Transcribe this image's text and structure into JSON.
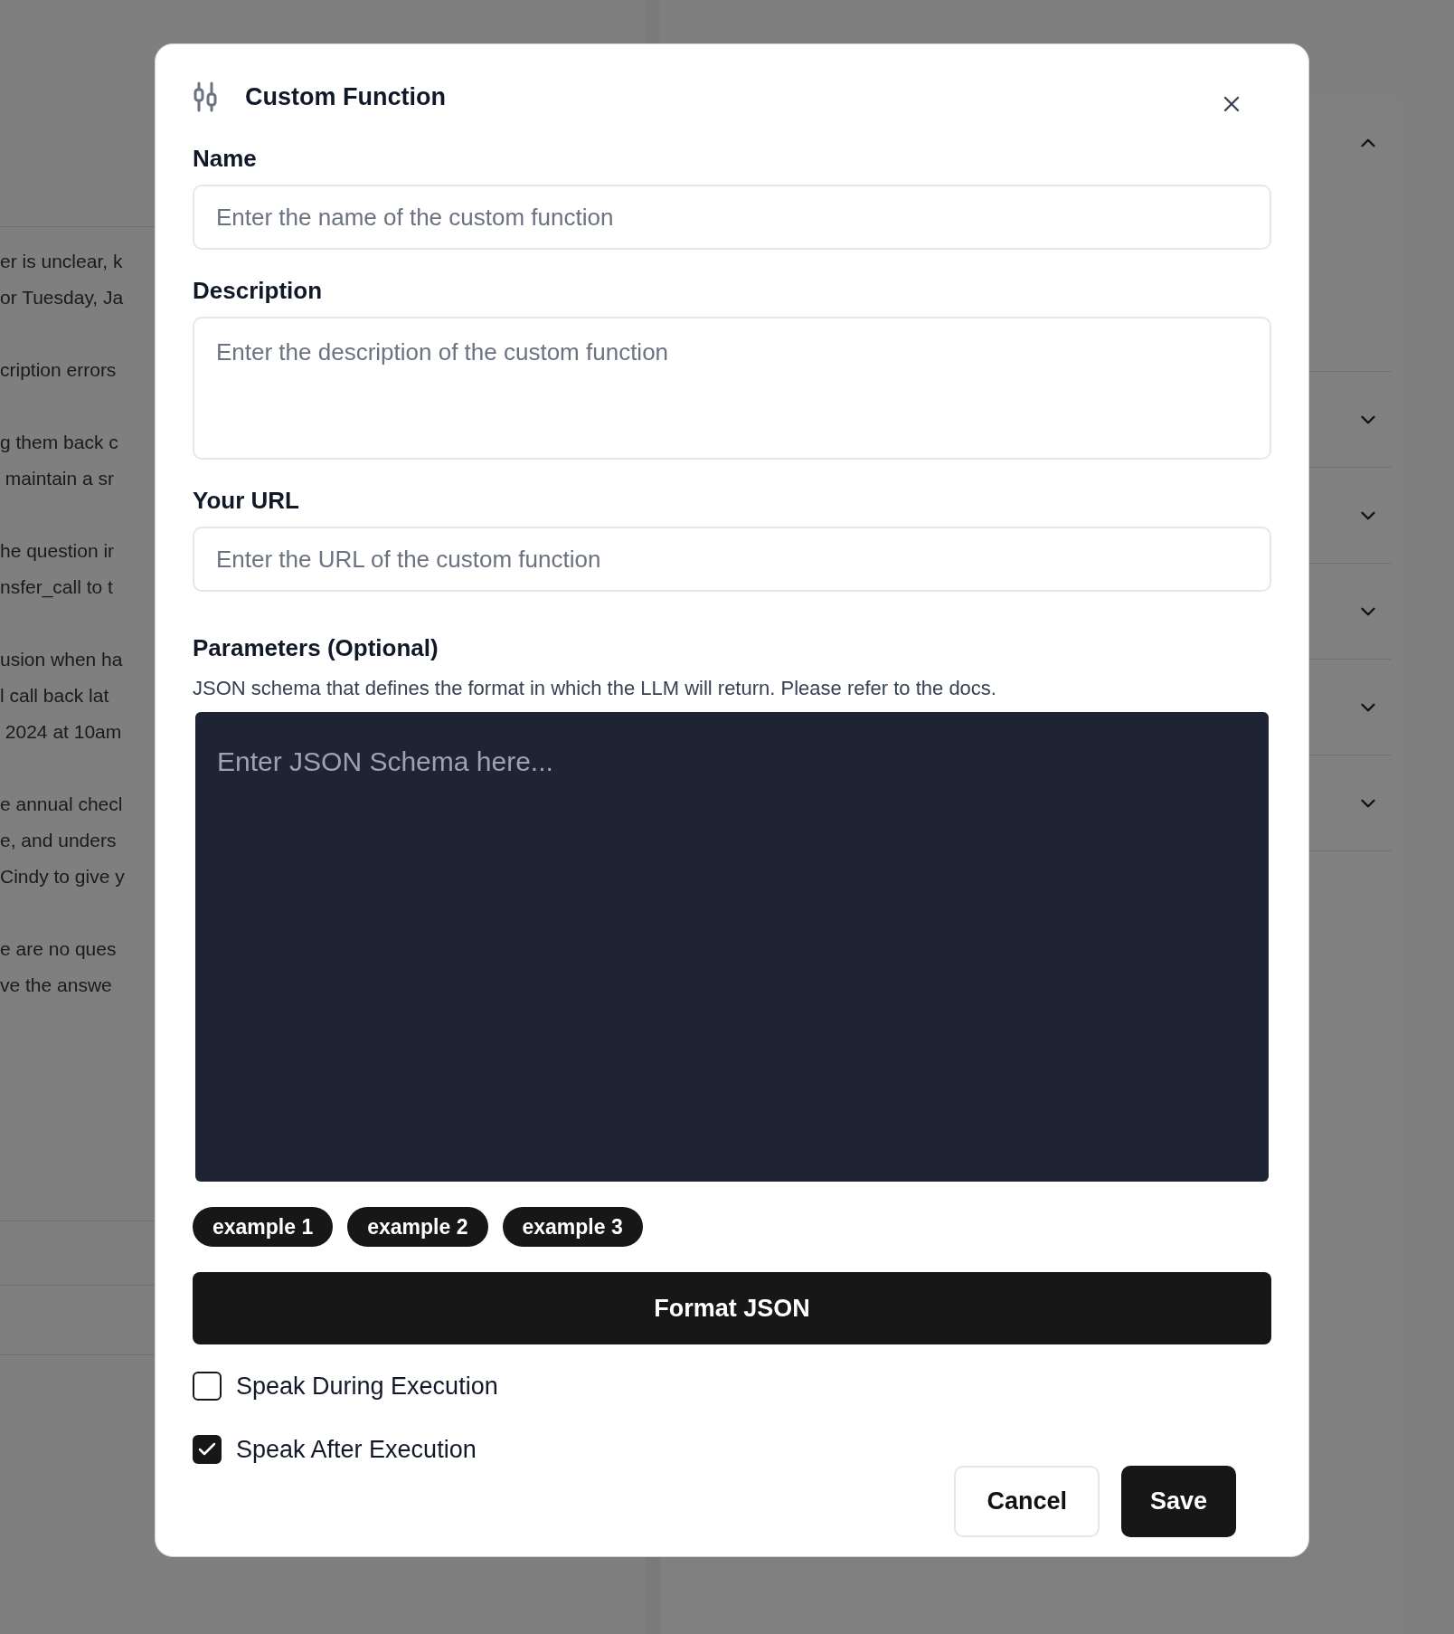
{
  "background": {
    "left_paragraphs": [
      [
        "er is unclear, k",
        "or Tuesday, Ja"
      ],
      [
        "cription errors"
      ],
      [
        "g them back c",
        " maintain a sr"
      ],
      [
        "he question ir",
        "nsfer_call to t"
      ],
      [
        "usion when ha",
        "l call back lat",
        " 2024 at 10am"
      ],
      [
        "e annual checl",
        "e, and unders",
        "Cindy to give y"
      ],
      [
        "e are no ques",
        "ve the answe"
      ]
    ],
    "accordion": [
      {
        "expanded": true
      },
      {
        "expanded": false
      },
      {
        "expanded": false
      },
      {
        "expanded": false
      },
      {
        "expanded": false
      },
      {
        "expanded": false
      }
    ]
  },
  "dialog": {
    "title": "Custom Function",
    "fields": [
      {
        "kind": "input",
        "label": "Name",
        "placeholder": "Enter the name of the custom function"
      },
      {
        "kind": "textarea",
        "label": "Description",
        "placeholder": "Enter the description of the custom function"
      },
      {
        "kind": "input",
        "label": "Your URL",
        "placeholder": "Enter the URL of the custom function"
      }
    ],
    "parameters": {
      "label": "Parameters (Optional)",
      "hint": "JSON schema that defines the format in which the LLM will return. Please refer to the docs.",
      "placeholder": "Enter JSON Schema here..."
    },
    "examples": [
      "example 1",
      "example 2",
      "example 3"
    ],
    "format_button": "Format JSON",
    "checkboxes": [
      {
        "label": "Speak During Execution",
        "checked": false
      },
      {
        "label": "Speak After Execution",
        "checked": true
      }
    ],
    "buttons": [
      {
        "label": "Cancel",
        "kind": "secondary"
      },
      {
        "label": "Save",
        "kind": "primary"
      }
    ]
  }
}
